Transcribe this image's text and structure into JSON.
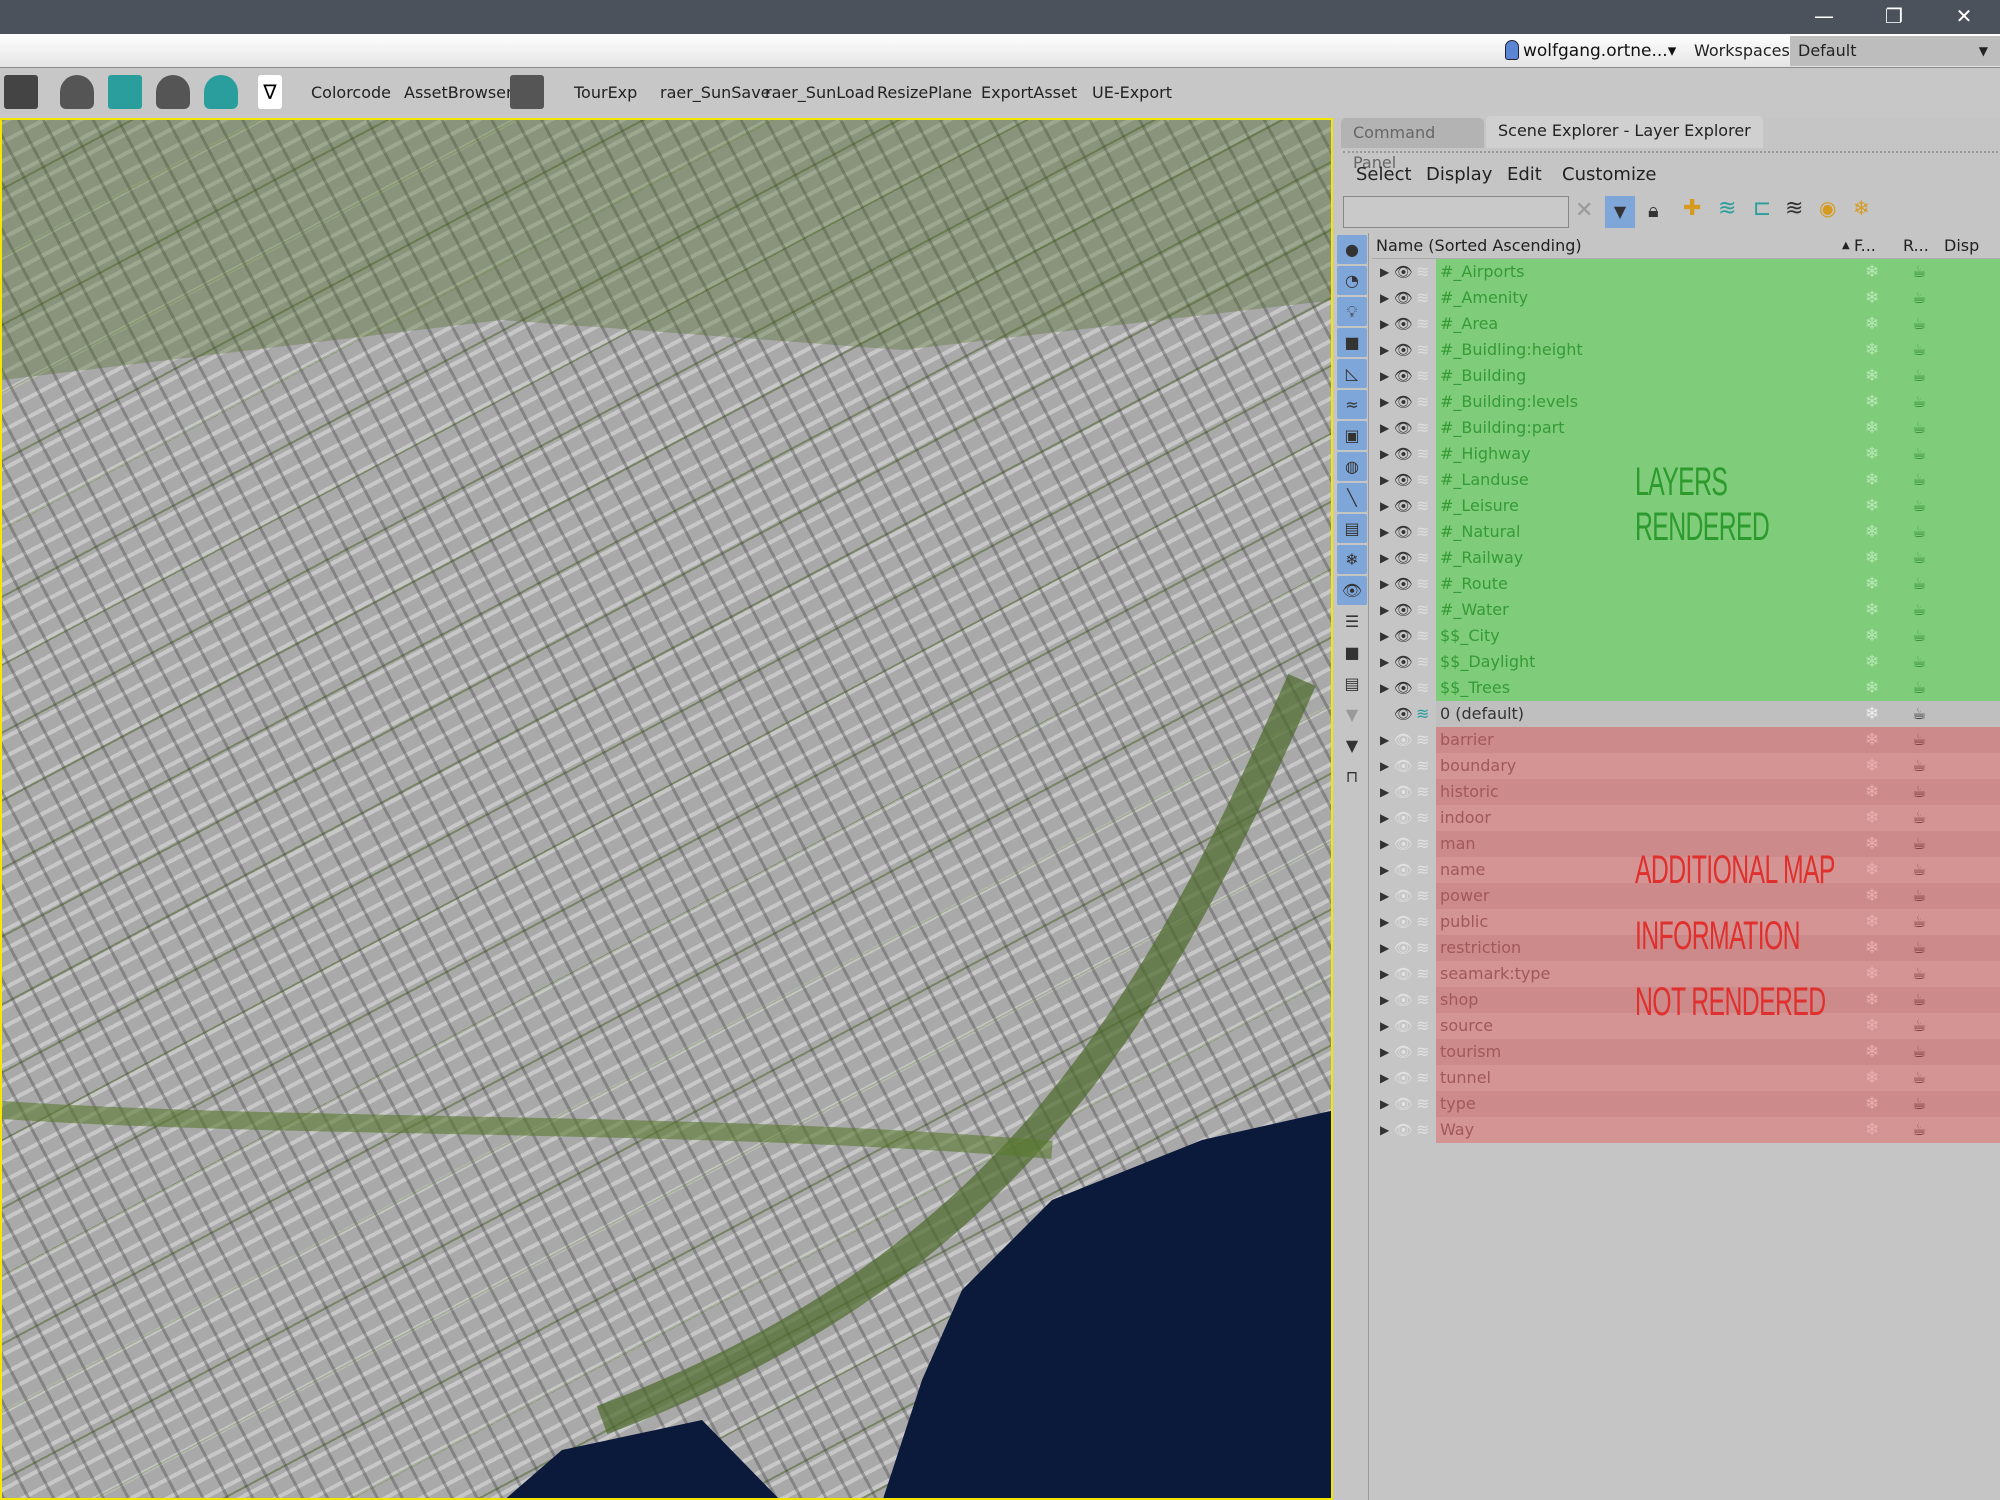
{
  "window": {
    "minimize": "—",
    "restore": "❐",
    "close": "✕"
  },
  "account": {
    "user": "wolfgang.ortne...▾",
    "workspaces_label": "Workspaces:",
    "workspace": "Default"
  },
  "toolbar": {
    "buttons": [
      "Colorcode",
      "AssetBrowser",
      "TourExp",
      "raer_SunSave",
      "raer_SunLoad",
      "ResizePlane",
      "ExportAsset",
      "UE-Export"
    ]
  },
  "panel": {
    "tabs": [
      "Command Panel",
      "Scene Explorer - Layer Explorer"
    ],
    "menu": [
      "Select",
      "Display",
      "Edit",
      "Customize"
    ],
    "search_value": "",
    "columns": {
      "name": "Name (Sorted Ascending)",
      "f": "F...",
      "r": "R...",
      "disp": "Disp"
    },
    "rendered_layers": [
      "#_Airports",
      "#_Amenity",
      "#_Area",
      "#_Buidling:height",
      "#_Building",
      "#_Building:levels",
      "#_Building:part",
      "#_Highway",
      "#_Landuse",
      "#_Leisure",
      "#_Natural",
      "#_Railway",
      "#_Route",
      "#_Water",
      "$$_City",
      "$$_Daylight",
      "$$_Trees"
    ],
    "default_layer": "0 (default)",
    "hidden_layers": [
      "barrier",
      "boundary",
      "historic",
      "indoor",
      "man",
      "name",
      "power",
      "public",
      "restriction",
      "seamark:type",
      "shop",
      "source",
      "tourism",
      "tunnel",
      "type",
      "Way"
    ]
  },
  "annotations": {
    "rendered": "LAYERS RENDERED",
    "not_rendered": [
      "ADDITIONAL MAP",
      "INFORMATION",
      "NOT RENDERED"
    ]
  },
  "colors": {
    "rendered": "#7fcd7a",
    "not_rendered": "#cd8a8a",
    "accent": "#7fa6d9",
    "viewport_border": "#f4e600",
    "water": "#0a1a3a"
  }
}
